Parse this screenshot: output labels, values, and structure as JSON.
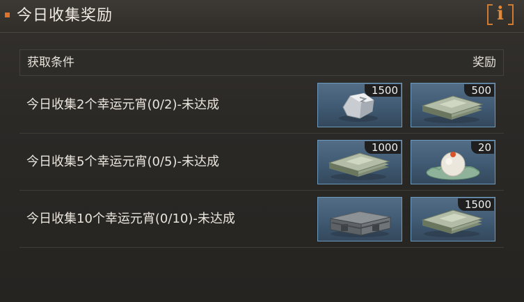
{
  "window": {
    "title": "今日收集奖励",
    "info_label": "i"
  },
  "table": {
    "header_condition": "获取条件",
    "header_reward": "奖励"
  },
  "rows": [
    {
      "condition": "今日收集2个幸运元宵(0/2)-未达成",
      "rewards": [
        {
          "icon": "silver-ingot-icon",
          "quantity": "1500"
        },
        {
          "icon": "cash-stack-icon",
          "quantity": "500"
        }
      ]
    },
    {
      "condition": "今日收集5个幸运元宵(0/5)-未达成",
      "rewards": [
        {
          "icon": "cash-stack-icon",
          "quantity": "1000"
        },
        {
          "icon": "yuanxiao-dumpling-icon",
          "quantity": "20"
        }
      ]
    },
    {
      "condition": "今日收集10个幸运元宵(0/10)-未达成",
      "rewards": [
        {
          "icon": "supply-crate-icon",
          "quantity": ""
        },
        {
          "icon": "cash-stack-icon",
          "quantity": "1500"
        }
      ]
    }
  ],
  "colors": {
    "accent": "#e0732a",
    "slot_border": "#6d9bc0",
    "slot_bg": "#46607a"
  }
}
